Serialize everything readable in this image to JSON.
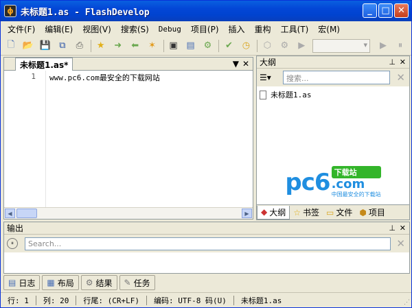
{
  "window": {
    "title": "未标题1.as - FlashDevelop",
    "app_icon": "flashdevelop-icon"
  },
  "menu": [
    "文件(F)",
    "编辑(E)",
    "视图(V)",
    "搜索(S)",
    "Debug",
    "项目(P)",
    "插入",
    "重构",
    "工具(T)",
    "宏(M)"
  ],
  "editor": {
    "tab_label": "未标题1.as*",
    "line_number": "1",
    "code_line": "www.pc6.com最安全的下载网站"
  },
  "outline": {
    "title": "大纲",
    "search_placeholder": "搜索...",
    "tree_item": "未标题1.as",
    "tabs": [
      "大纲",
      "书签",
      "文件",
      "项目"
    ],
    "logo": {
      "main": "pc6",
      "badge": "下载站",
      "com": ".com",
      "sub": "中国最安全的下载站"
    }
  },
  "output": {
    "title": "输出",
    "search_placeholder": "Search..."
  },
  "bottom_tabs": [
    "日志",
    "布局",
    "结果",
    "任务"
  ],
  "status": {
    "line": "行: 1",
    "col": "列: 20",
    "eol": "行尾: (CR+LF)",
    "encoding": "编码: UTF-8 码(U)",
    "file": "未标题1.as"
  }
}
